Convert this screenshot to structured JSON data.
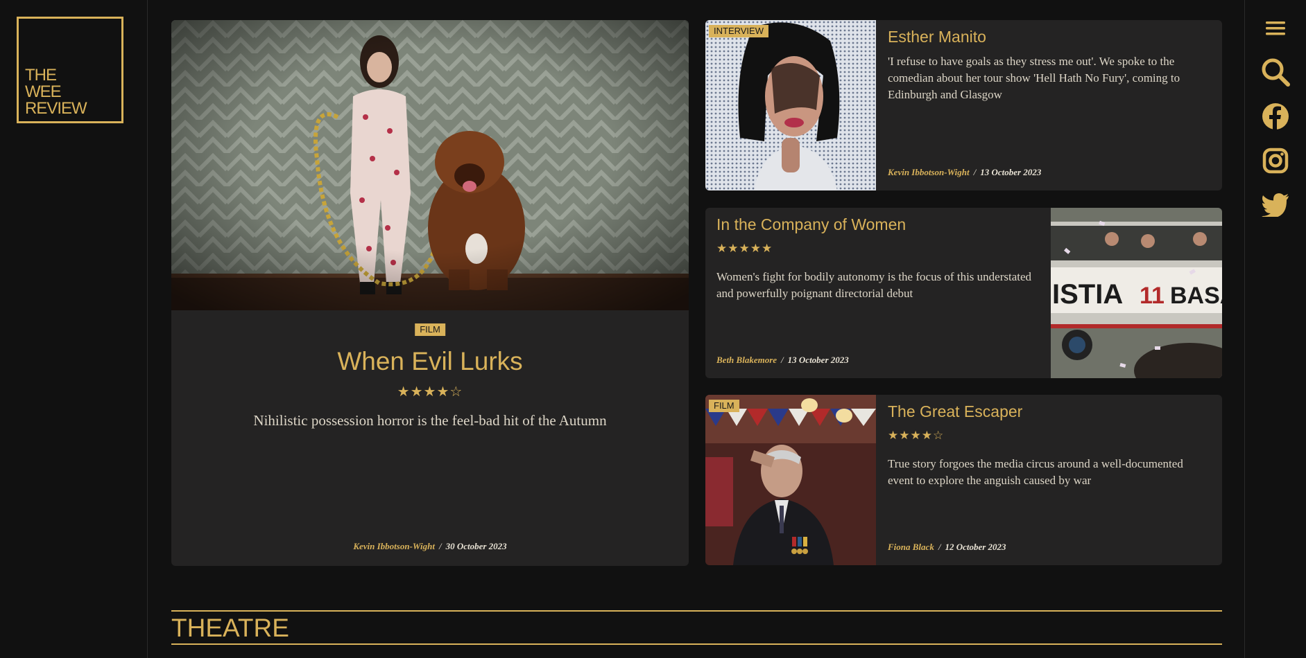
{
  "logo": {
    "line1": "THE",
    "line2": "WEE",
    "line3": "REVIEW"
  },
  "right_nav": {
    "menu_icon": "hamburger-menu-icon",
    "search_icon": "search-icon",
    "social": [
      "facebook-icon",
      "instagram-icon",
      "twitter-icon"
    ]
  },
  "accent_color": "#d9b25a",
  "featured": {
    "tag": "FILM",
    "title": "When Evil Lurks",
    "rating": 4,
    "stars": "★★★★☆",
    "description": "Nihilistic possession horror is the feel-bad hit of the Autumn",
    "author": "Kevin Ibbotson-Wight",
    "separator": "/",
    "date": "30 October 2023"
  },
  "articles": [
    {
      "tag": "INTERVIEW",
      "title": "Esther Manito",
      "description": "'I refuse to have goals as they stress me out'. We spoke to the comedian about her tour show 'Hell Hath No Fury', coming to Edinburgh and Glasgow",
      "author": "Kevin Ibbotson-Wight",
      "separator": "/",
      "date": "13 October 2023"
    },
    {
      "title": "In the Company of Women",
      "rating": 5,
      "stars": "★★★★★",
      "description": "Women's fight for bodily autonomy is the focus of this understated and powerfully poignant directorial debut",
      "author": "Beth Blakemore",
      "separator": "/",
      "date": "13 October 2023"
    },
    {
      "tag": "FILM",
      "title": "The Great Escaper",
      "rating": 4,
      "stars": "★★★★☆",
      "description": "True story forgoes the media circus around a well-documented event to explore the anguish caused by war",
      "author": "Fiona Black",
      "separator": "/",
      "date": "12 October 2023"
    }
  ],
  "section": {
    "heading": "THEATRE"
  }
}
